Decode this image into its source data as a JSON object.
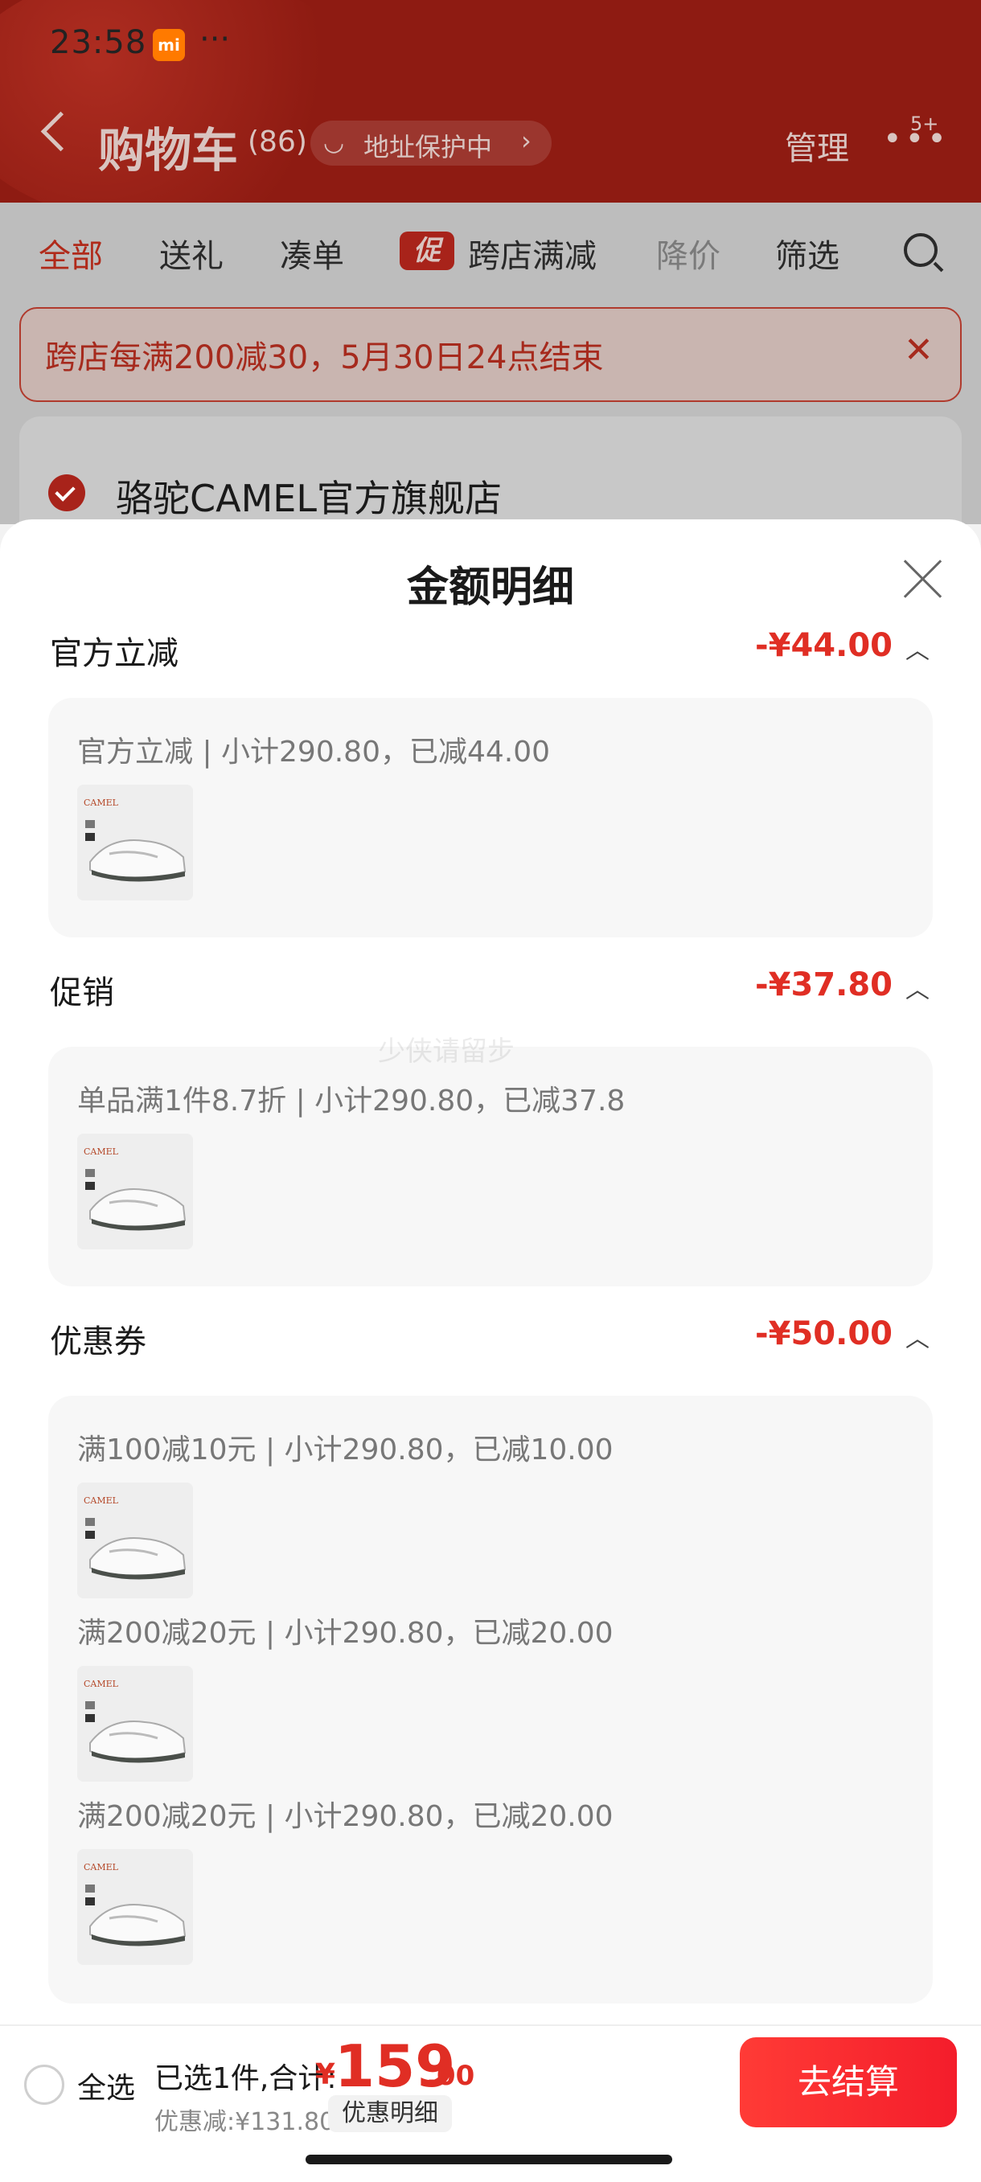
{
  "status_bar": {
    "time": "23:58",
    "mi_badge": "mi",
    "more": "···"
  },
  "header": {
    "title": "购物车",
    "count": "(86)",
    "address_protection": "地址保护中",
    "manage": "管理",
    "more_badge": "5+"
  },
  "tabs": [
    {
      "label": "全部"
    },
    {
      "label": "送礼"
    },
    {
      "label": "凑单"
    },
    {
      "label": "跨店满减",
      "tag": "促"
    },
    {
      "label": "降价"
    },
    {
      "label": "筛选"
    }
  ],
  "banner": {
    "text": "跨店每满200减30，5月30日24点结束"
  },
  "shop": {
    "name": "骆驼CAMEL官方旗舰店"
  },
  "sheet": {
    "title": "金额明细",
    "sections": [
      {
        "label": "官方立减",
        "amount": "-¥44.00",
        "lines": [
          "官方立减 | 小计290.80，已减44.00"
        ]
      },
      {
        "label": "促销",
        "amount": "-¥37.80",
        "lines": [
          "单品满1件8.7折 | 小计290.80，已减37.8"
        ]
      },
      {
        "label": "优惠券",
        "amount": "-¥50.00",
        "lines": [
          "满100减10元 | 小计290.80，已减10.00",
          "满200减20元 | 小计290.80，已减20.00",
          "满200减20元 | 小计290.80，已减20.00"
        ]
      }
    ]
  },
  "watermark": "少侠请留步",
  "footer": {
    "select_all": "全选",
    "selected_summary": "已选1件,合计:",
    "yen": "¥",
    "price_int": "159",
    "price_dec": ".00",
    "discount": "优惠减:¥131.80",
    "detail_button": "优惠明细",
    "checkout": "去结算"
  },
  "colors": {
    "accent": "#e02e24",
    "header_bg": "#8e1b12",
    "checkout_bg": "#f41d2b"
  },
  "icons": [
    "back-icon",
    "chevron-right-icon",
    "close-icon",
    "search-icon",
    "more-icon",
    "checkmark-icon",
    "caret-up-icon",
    "product-thumbnail"
  ]
}
